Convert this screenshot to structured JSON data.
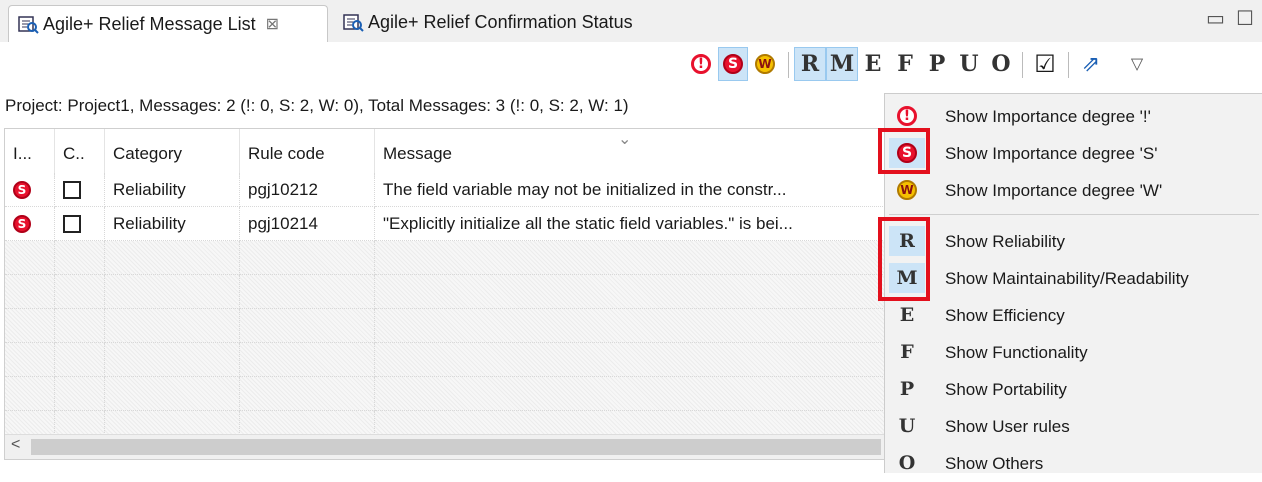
{
  "tabs": [
    {
      "label": "Agile+ Relief Message List",
      "close": "⊠"
    },
    {
      "label": "Agile+ Relief Confirmation Status"
    }
  ],
  "window_buttons": {
    "minimize": "▭",
    "maximize": "☐"
  },
  "toolbar": {
    "importance": [
      "!",
      "S",
      "W"
    ],
    "letters": [
      "R",
      "M",
      "E",
      "F",
      "P",
      "U",
      "O"
    ],
    "checkbox_glyph": "☑",
    "export_glyph": "⇗",
    "menu_glyph": "▽"
  },
  "summary": "Project: Project1,  Messages: 2 (!: 0, S: 2, W: 0),  Total Messages: 3 (!: 0, S: 2, W: 1)",
  "table": {
    "columns": [
      "I...",
      "C..",
      "Category",
      "Rule code",
      "Message"
    ],
    "sort_glyph": "⌄",
    "rows": [
      {
        "importance": "S",
        "category": "Reliability",
        "rule_code": "pgj10212",
        "message": "The field variable may not be initialized in the constr..."
      },
      {
        "importance": "S",
        "category": "Reliability",
        "rule_code": "pgj10214",
        "message": "\"Explicitly initialize all the static field variables.\" is bei..."
      }
    ],
    "scroll_left": "<"
  },
  "menu": {
    "items": [
      {
        "icon": "!",
        "label": "Show Importance degree '!'"
      },
      {
        "icon": "S",
        "label": "Show Importance degree 'S'"
      },
      {
        "icon": "W",
        "label": "Show Importance degree 'W'"
      },
      {
        "icon": "R",
        "label": "Show Reliability"
      },
      {
        "icon": "M",
        "label": "Show Maintainability/Readability"
      },
      {
        "icon": "E",
        "label": "Show Efficiency"
      },
      {
        "icon": "F",
        "label": "Show Functionality"
      },
      {
        "icon": "P",
        "label": "Show Portability"
      },
      {
        "icon": "U",
        "label": "Show User rules"
      },
      {
        "icon": "O",
        "label": "Show Others"
      }
    ]
  },
  "colors": {
    "highlight": "#cce4f7",
    "annotation": "#e3101d",
    "importance_red": "#e8112d",
    "importance_yellow": "#f6c000"
  }
}
